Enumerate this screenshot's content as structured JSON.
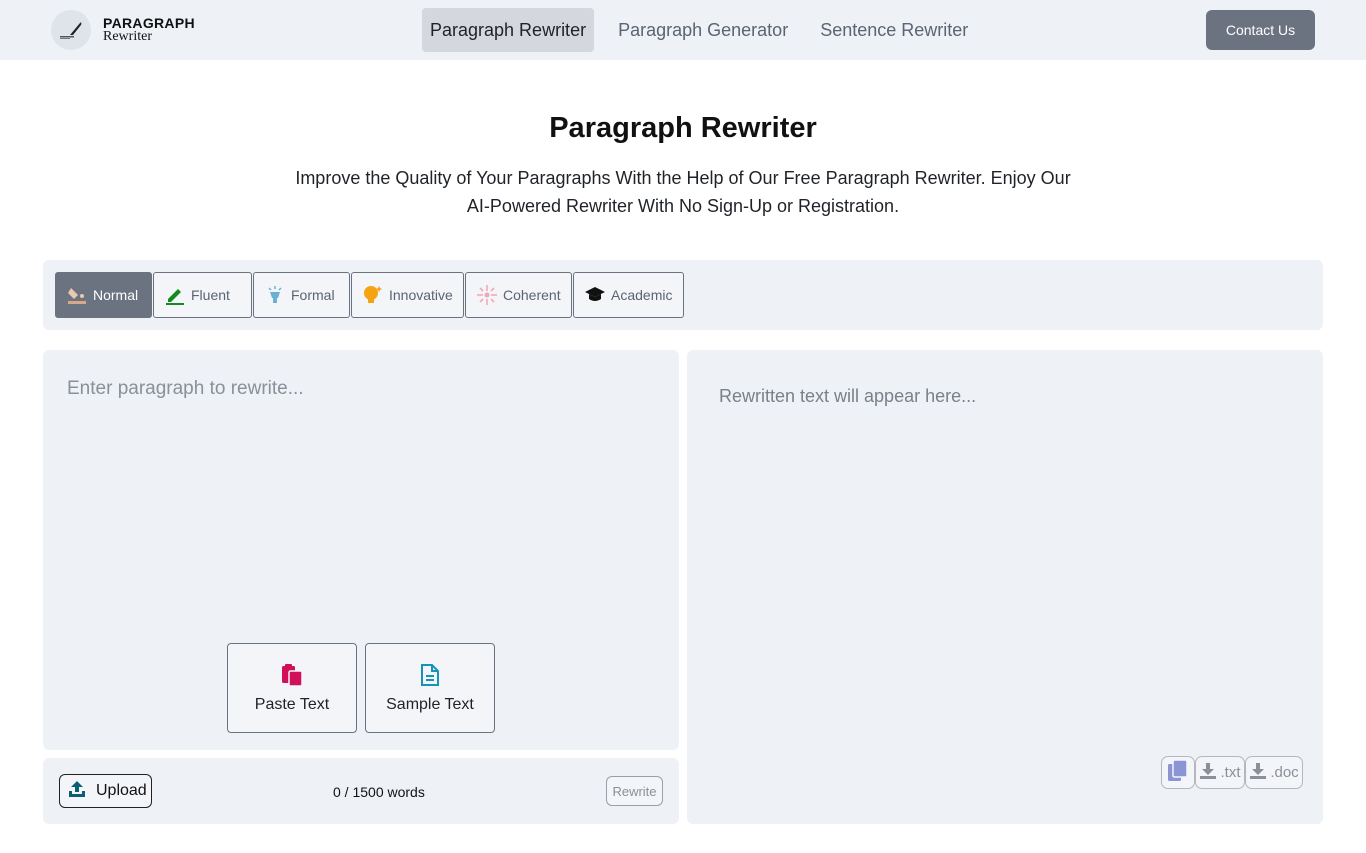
{
  "header": {
    "logo_brand": "PARAGRAPH",
    "logo_sub": "Rewriter",
    "nav": [
      {
        "label": "Paragraph Rewriter",
        "active": true
      },
      {
        "label": "Paragraph Generator",
        "active": false
      },
      {
        "label": "Sentence Rewriter",
        "active": false
      }
    ],
    "contact_label": "Contact Us"
  },
  "hero": {
    "title": "Paragraph Rewriter",
    "description_line1": "Improve the Quality of Your Paragraphs With the Help of Our Free Paragraph Rewriter. Enjoy Our",
    "description_line2": "AI-Powered Rewriter With No Sign-Up or Registration."
  },
  "modes": [
    {
      "label": "Normal",
      "icon": "paint-bucket-icon",
      "active": true
    },
    {
      "label": "Fluent",
      "icon": "pencil-icon",
      "active": false
    },
    {
      "label": "Formal",
      "icon": "lamp-icon",
      "active": false
    },
    {
      "label": "Innovative",
      "icon": "lightbulb-icon",
      "active": false
    },
    {
      "label": "Coherent",
      "icon": "sparkle-icon",
      "active": false
    },
    {
      "label": "Academic",
      "icon": "graduation-cap-icon",
      "active": false
    }
  ],
  "input": {
    "placeholder": "Enter paragraph to rewrite...",
    "paste_label": "Paste Text",
    "sample_label": "Sample Text",
    "upload_label": "Upload",
    "word_count": "0 / 1500 words",
    "rewrite_label": "Rewrite"
  },
  "output": {
    "placeholder": "Rewritten text will appear here...",
    "txt_label": ".txt",
    "doc_label": ".doc"
  },
  "colors": {
    "accent_gray": "#6b7280",
    "panel_bg": "#eef1f6",
    "paste_icon": "#d1105a",
    "sample_icon": "#1594b5",
    "upload_icon": "#0b5f73",
    "copy_icon": "#8b95d6"
  }
}
